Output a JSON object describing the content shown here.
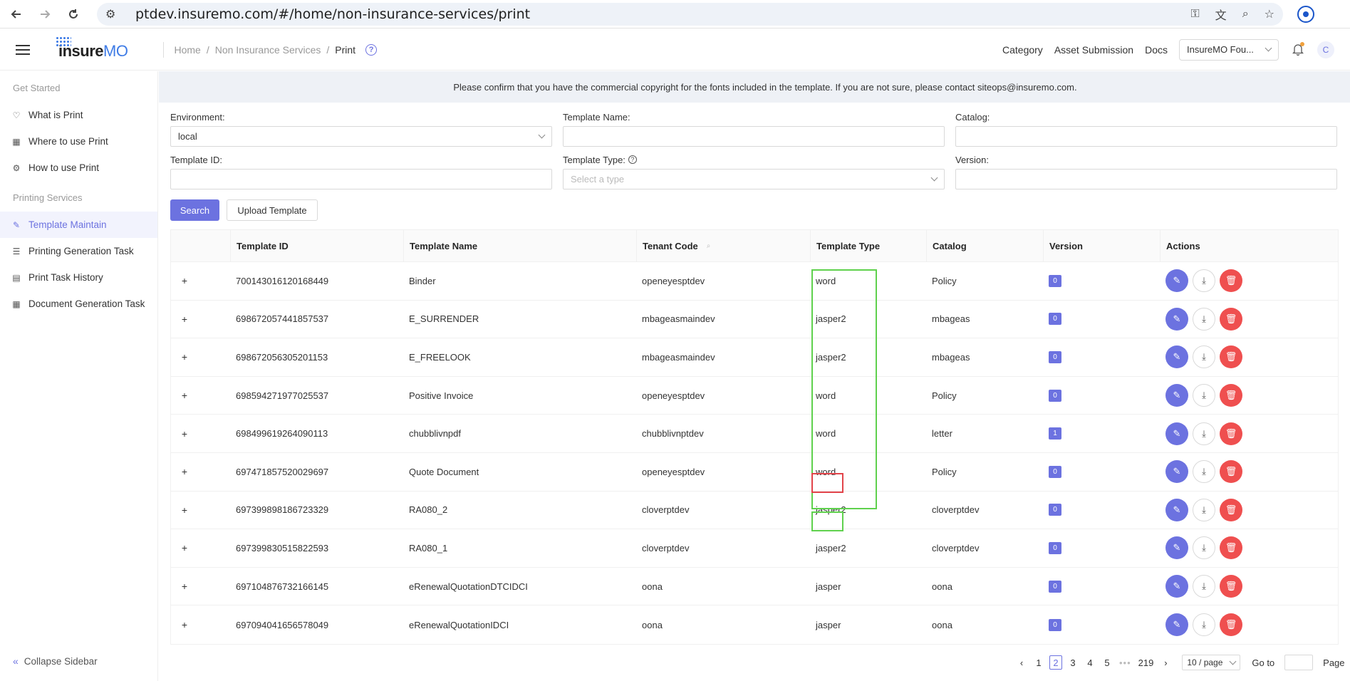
{
  "browser": {
    "url": "ptdev.insuremo.com/#/home/non-insurance-services/print"
  },
  "header": {
    "logo_ins": "insure",
    "logo_mo": "MO",
    "breadcrumb": [
      "Home",
      "Non Insurance Services",
      "Print"
    ],
    "links": [
      "Category",
      "Asset Submission",
      "Docs"
    ],
    "workspace": "InsureMO Fou...",
    "avatar": "C"
  },
  "sidebar": {
    "groups": [
      {
        "title": "Get Started",
        "items": [
          {
            "label": "What is Print",
            "icon": "lightbulb-icon"
          },
          {
            "label": "Where to use Print",
            "icon": "grid-icon"
          },
          {
            "label": "How to use Print",
            "icon": "gear-icon"
          }
        ]
      },
      {
        "title": "Printing Services",
        "items": [
          {
            "label": "Template Maintain",
            "icon": "wrench-icon",
            "active": true
          },
          {
            "label": "Printing Generation Task",
            "icon": "list-icon"
          },
          {
            "label": "Print Task History",
            "icon": "document-icon"
          },
          {
            "label": "Document Generation Task",
            "icon": "grid-icon"
          }
        ]
      }
    ],
    "collapse_label": "Collapse Sidebar"
  },
  "notice": "Please confirm that you have the commercial copyright for the fonts included in the template. If you are not sure, please contact siteops@insuremo.com.",
  "filters": {
    "environment_label": "Environment:",
    "environment_value": "local",
    "template_name_label": "Template Name:",
    "template_name_value": "",
    "catalog_label": "Catalog:",
    "catalog_value": "",
    "template_id_label": "Template ID:",
    "template_id_value": "",
    "template_type_label": "Template Type:",
    "template_type_placeholder": "Select a type",
    "version_label": "Version:",
    "version_value": ""
  },
  "buttons": {
    "search": "Search",
    "upload": "Upload Template"
  },
  "table": {
    "columns": [
      "",
      "Template ID",
      "Template Name",
      "Tenant Code",
      "Template Type",
      "Catalog",
      "Version",
      "Actions"
    ],
    "rows": [
      {
        "id": "700143016120168449",
        "name": "Binder",
        "tenant": "openeyesptdev",
        "type": "word",
        "catalog": "Policy",
        "version": "0"
      },
      {
        "id": "698672057441857537",
        "name": "E_SURRENDER",
        "tenant": "mbageasmaindev",
        "type": "jasper2",
        "catalog": "mbageas",
        "version": "0"
      },
      {
        "id": "698672056305201153",
        "name": "E_FREELOOK",
        "tenant": "mbageasmaindev",
        "type": "jasper2",
        "catalog": "mbageas",
        "version": "0"
      },
      {
        "id": "698594271977025537",
        "name": "Positive Invoice",
        "tenant": "openeyesptdev",
        "type": "word",
        "catalog": "Policy",
        "version": "0"
      },
      {
        "id": "698499619264090113",
        "name": "chubblivnpdf",
        "tenant": "chubblivnptdev",
        "type": "word",
        "catalog": "letter",
        "version": "1"
      },
      {
        "id": "697471857520029697",
        "name": "Quote Document",
        "tenant": "openeyesptdev",
        "type": "word",
        "catalog": "Policy",
        "version": "0"
      },
      {
        "id": "697399898186723329",
        "name": "RA080_2",
        "tenant": "cloverptdev",
        "type": "jasper2",
        "catalog": "cloverptdev",
        "version": "0"
      },
      {
        "id": "697399830515822593",
        "name": "RA080_1",
        "tenant": "cloverptdev",
        "type": "jasper2",
        "catalog": "cloverptdev",
        "version": "0"
      },
      {
        "id": "697104876732166145",
        "name": "eRenewalQuotationDTCIDCI",
        "tenant": "oona",
        "type": "jasper",
        "catalog": "oona",
        "version": "0"
      },
      {
        "id": "697094041656578049",
        "name": "eRenewalQuotationIDCI",
        "tenant": "oona",
        "type": "jasper",
        "catalog": "oona",
        "version": "0"
      }
    ]
  },
  "pagination": {
    "pages": [
      "1",
      "2",
      "3",
      "4",
      "5"
    ],
    "current": "2",
    "ellipsis": "•••",
    "last": "219",
    "page_size": "10 / page",
    "goto_label": "Go to",
    "page_label": "Page"
  },
  "colors": {
    "accent": "#6c72e0",
    "danger": "#ef4f4f",
    "highlight_green": "#5fd14d",
    "highlight_red": "#e2444a"
  }
}
